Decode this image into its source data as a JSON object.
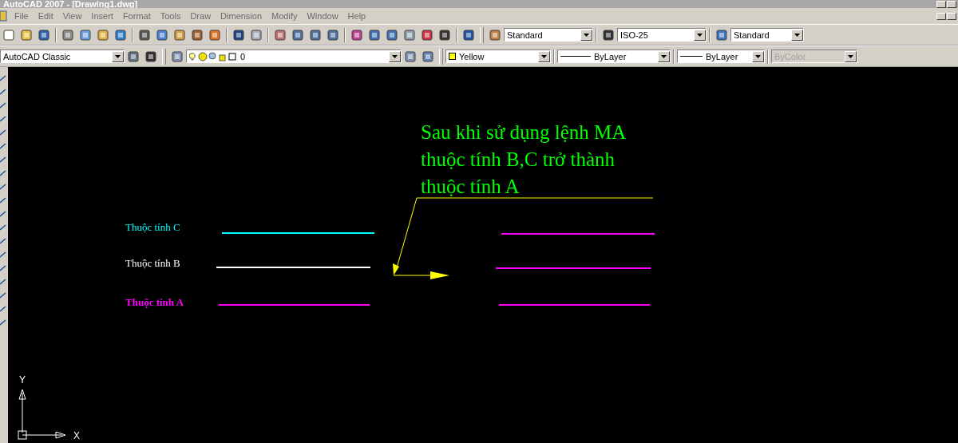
{
  "window": {
    "title": "AutoCAD 2007 - [Drawing1.dwg]"
  },
  "menu": [
    "File",
    "Edit",
    "View",
    "Insert",
    "Format",
    "Tools",
    "Draw",
    "Dimension",
    "Modify",
    "Window",
    "Help"
  ],
  "styles_toolbar": {
    "text_style": "Standard",
    "dim_style": "ISO-25",
    "table_style": "Standard"
  },
  "workspace": {
    "value": "AutoCAD Classic"
  },
  "layer": {
    "value": "0"
  },
  "properties": {
    "color_setting": {
      "name": "Yellow",
      "color": "#ffff00"
    },
    "linetype": "ByLayer",
    "lineweight": "ByLayer",
    "plot_style": "ByColor",
    "plot_style_disabled": true
  },
  "canvas": {
    "note": [
      "Sau khi sử dụng lệnh MA",
      "thuộc tính B,C trở thành",
      "thuộc tính A"
    ],
    "rows": [
      {
        "label": "Thuộc tính C",
        "color": "#00ffff",
        "bold": false,
        "result": {
          "color": "#ff00ff"
        }
      },
      {
        "label": "Thuộc tính B",
        "color": "#ffffff",
        "bold": false,
        "result": {
          "color": "#ff00ff"
        }
      },
      {
        "label": "Thuộc tính A",
        "color": "#ff00ff",
        "bold": true,
        "result": {
          "color": "#ff00ff"
        }
      }
    ],
    "ucs": {
      "x": "X",
      "y": "Y"
    }
  }
}
